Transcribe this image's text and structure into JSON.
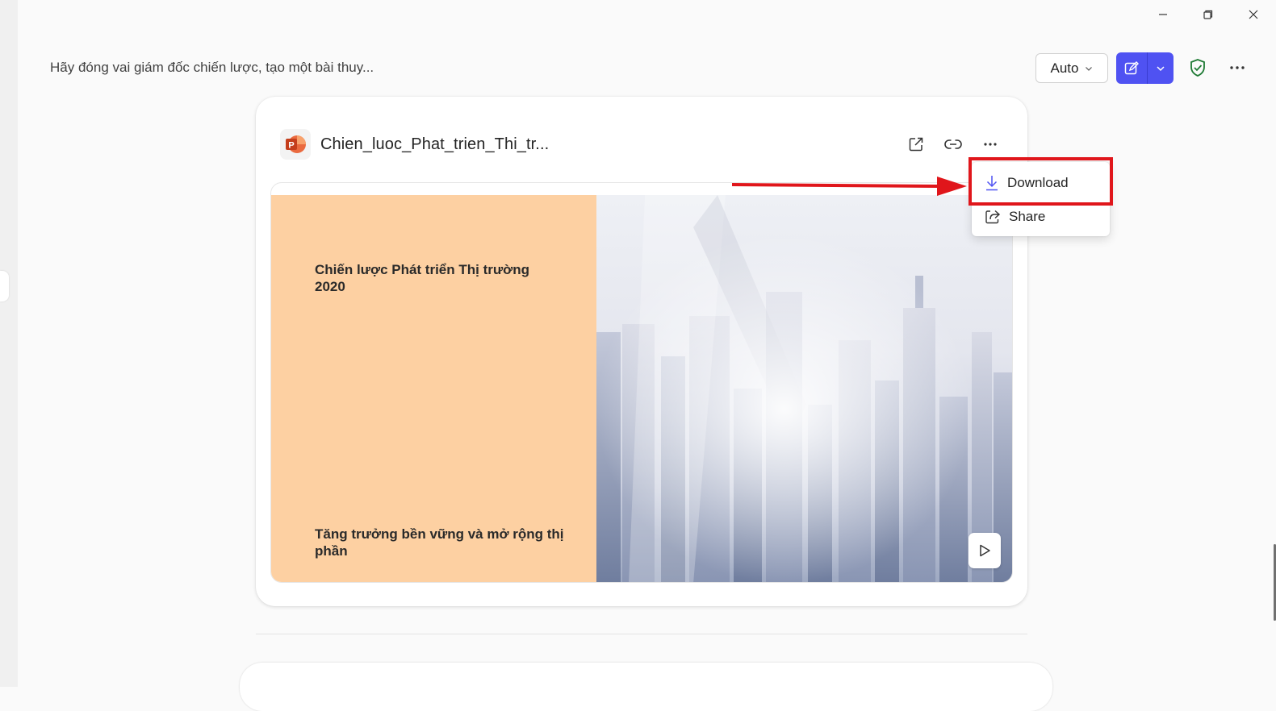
{
  "window": {
    "minimize_icon": "minimize-icon",
    "restore_icon": "restore-icon",
    "close_icon": "close-icon"
  },
  "header": {
    "title": "Hãy đóng vai giám đốc chiến lược, tạo một bài thuy...",
    "mode_label": "Auto",
    "compose_icon": "compose-icon",
    "shield_icon": "shield-check-icon",
    "more_icon": "more-horizontal-icon"
  },
  "file_card": {
    "file_icon": "powerpoint-icon",
    "file_name": "Chien_luoc_Phat_trien_Thi_tr...",
    "actions": [
      "open-external-icon",
      "link-icon",
      "more-horizontal-icon"
    ],
    "slide": {
      "title": "Chiến lược Phát triển Thị trường 2020",
      "subtitle": "Tăng trưởng bền vững và mở rộng thị phần"
    }
  },
  "menu": {
    "download_label": "Download",
    "share_label": "Share"
  },
  "colors": {
    "accent": "#4f52f2",
    "slide_panel": "#fdd0a2",
    "annotation": "#e0161b",
    "shield": "#1e7a34",
    "powerpoint": "#d04423"
  }
}
